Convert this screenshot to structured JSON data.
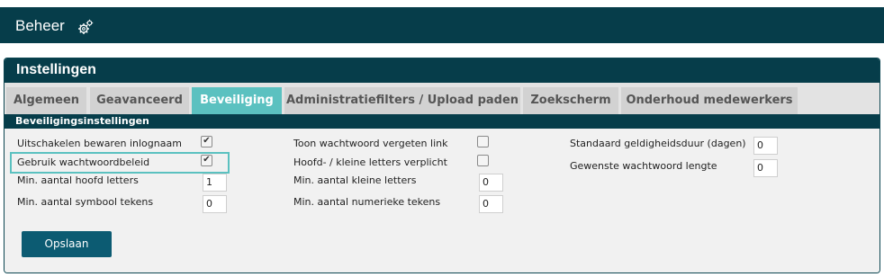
{
  "topbar": {
    "title": "Beheer",
    "icon": "gears-icon"
  },
  "panel": {
    "title": "Instellingen"
  },
  "tabs": [
    {
      "label": "Algemeen",
      "active": false
    },
    {
      "label": "Geavanceerd",
      "active": false
    },
    {
      "label": "Beveiliging",
      "active": true
    },
    {
      "label": "Administratiefilters / Upload paden",
      "active": false
    },
    {
      "label": "Zoekscherm",
      "active": false
    },
    {
      "label": "Onderhoud medewerkers",
      "active": false
    }
  ],
  "section": {
    "title": "Beveiligingsinstellingen"
  },
  "fields": {
    "disable_save_login": {
      "label": "Uitschakelen bewaren inlognaam",
      "checked": true
    },
    "use_password_policy": {
      "label": "Gebruik wachtwoordbeleid",
      "checked": true
    },
    "min_upper": {
      "label": "Min. aantal hoofd letters",
      "value": "1"
    },
    "min_symbols": {
      "label": "Min. aantal symbool tekens",
      "value": "0"
    },
    "show_forgot_link": {
      "label": "Toon wachtwoord vergeten link",
      "checked": false
    },
    "case_required": {
      "label": "Hoofd- / kleine letters verplicht",
      "checked": false
    },
    "min_lower": {
      "label": "Min. aantal kleine letters",
      "value": "0"
    },
    "min_numeric": {
      "label": "Min. aantal numerieke tekens",
      "value": "0"
    },
    "validity_days": {
      "label": "Standaard geldigheidsduur (dagen)",
      "value": "0"
    },
    "password_length": {
      "label": "Gewenste wachtwoord lengte",
      "value": "0"
    }
  },
  "save_button": {
    "label": "Opslaan"
  },
  "colors": {
    "header": "#063d4a",
    "active_tab": "#5bc1c0",
    "button": "#0c5b72"
  }
}
